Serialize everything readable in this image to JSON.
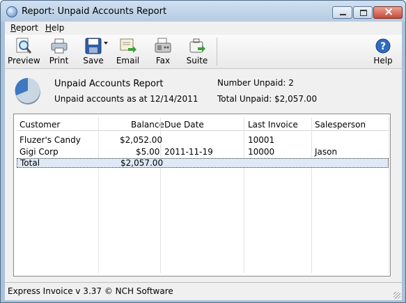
{
  "window": {
    "title": "Report: Unpaid Accounts Report"
  },
  "menu": {
    "items": [
      "Report",
      "Help"
    ]
  },
  "toolbar": {
    "preview": "Preview",
    "print": "Print",
    "save": "Save",
    "email": "Email",
    "fax": "Fax",
    "suite": "Suite",
    "help": "Help"
  },
  "report": {
    "title": "Unpaid Accounts Report",
    "subtitle": "Unpaid accounts as at 12/14/2011",
    "number_unpaid": "Number Unpaid: 2",
    "total_unpaid": "Total Unpaid: $2,057.00"
  },
  "table": {
    "headers": [
      "Customer",
      "Balance",
      "Due Date",
      "Last Invoice",
      "Salesperson"
    ],
    "rows": [
      [
        "Fluzer's Candy",
        "$2,052.00",
        "",
        "10001",
        ""
      ],
      [
        "Gigi Corp",
        "$5.00",
        "2011-11-19",
        "10000",
        "Jason"
      ]
    ],
    "total": [
      "Total",
      "$2,057.00",
      "",
      "",
      ""
    ]
  },
  "status": {
    "text": "Express Invoice v 3.37 © NCH Software"
  },
  "colors": {
    "titlebar": "#b5cbe2",
    "selection": "#dfe9f5",
    "accent": "#2f6fbd"
  }
}
